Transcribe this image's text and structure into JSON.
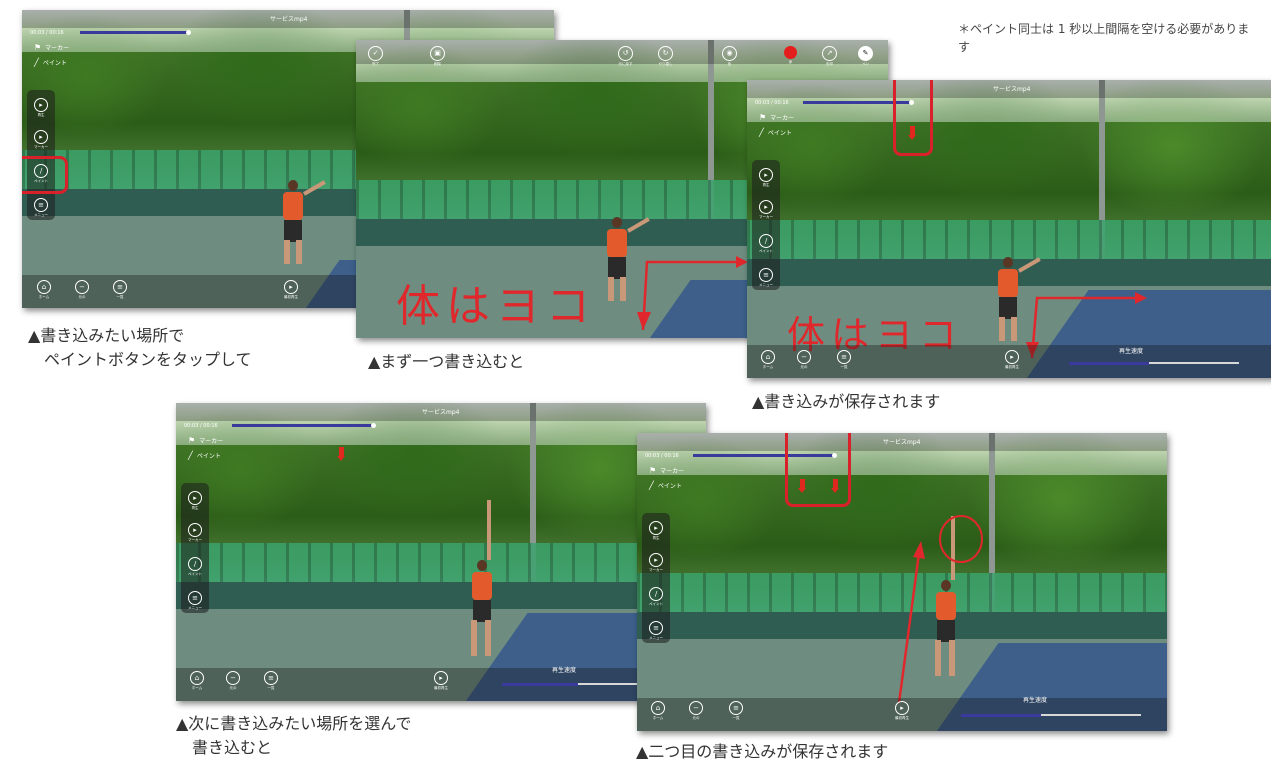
{
  "note": "＊ペイント同士は 1 秒以上間隔を空ける必要があります",
  "captions": {
    "c1": "▲書き込みたい場所で\n　ペイントボタンをタップして",
    "c2": "▲まず一つ書き込むと",
    "c3": "▲書き込みが保存されます",
    "c4": "▲次に書き込みたい場所を選んで\n　書き込むと",
    "c5": "▲二つ目の書き込みが保存されます"
  },
  "player_ui": {
    "filename": "サービスmp4",
    "timecode": "00:03 / 00:16",
    "marker_label": "マーカー",
    "paint_label": "ペイント",
    "side_buttons": [
      {
        "icon": "play-icon",
        "label": "再生"
      },
      {
        "icon": "marker-icon",
        "label": "マーカー"
      },
      {
        "icon": "pencil-icon",
        "label": "ペイント"
      },
      {
        "icon": "menu-icon",
        "label": "メニュー"
      }
    ],
    "bottom_buttons": [
      {
        "icon": "home-icon",
        "label": "ホーム"
      },
      {
        "icon": "back-icon",
        "label": "元の"
      },
      {
        "icon": "list-icon",
        "label": "一覧"
      }
    ],
    "play_start_label": "最初再生",
    "speed_label": "再生速度",
    "handwriting": "体はヨコ",
    "colors": {
      "accent_red": "#d9212b",
      "timebar": "#3a3a9c",
      "record": "#e41d1d"
    }
  },
  "paint_toolbar": {
    "buttons": [
      {
        "icon": "check-icon",
        "label": "完了"
      },
      {
        "icon": "trash-icon",
        "label": "削除"
      },
      {
        "icon": "undo-icon",
        "label": "元に戻す"
      },
      {
        "icon": "redo-icon",
        "label": "やり直し"
      },
      {
        "icon": "palette-icon",
        "label": "色"
      },
      {
        "icon": "record-icon",
        "label": "赤"
      },
      {
        "icon": "arrow-icon",
        "label": "矢印"
      },
      {
        "icon": "pen-icon",
        "label": "ペン"
      }
    ]
  }
}
